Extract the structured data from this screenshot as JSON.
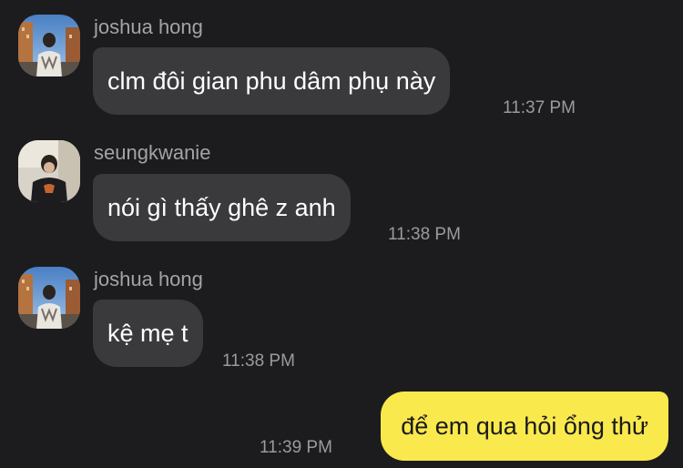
{
  "messages": [
    {
      "sender": "joshua hong",
      "avatar": "joshua-avatar",
      "text": "clm đôi gian phu dâm phụ này",
      "time": "11:37 PM",
      "outgoing": false
    },
    {
      "sender": "seungkwanie",
      "avatar": "seungkwanie-avatar",
      "text": "nói gì thấy ghê z anh",
      "time": "11:38 PM",
      "outgoing": false
    },
    {
      "sender": "joshua hong",
      "avatar": "joshua-avatar",
      "text": "kệ mẹ t",
      "time": "11:38 PM",
      "outgoing": false
    },
    {
      "sender": "",
      "avatar": "",
      "text": "để em qua hỏi ổng thử",
      "time": "11:39 PM",
      "outgoing": true
    }
  ],
  "colors": {
    "background": "#1c1c1e",
    "incoming_bubble": "#3a3a3c",
    "outgoing_bubble": "#fae94d",
    "sender_name": "#a3a3a8",
    "timestamp": "#9a9aa0"
  }
}
